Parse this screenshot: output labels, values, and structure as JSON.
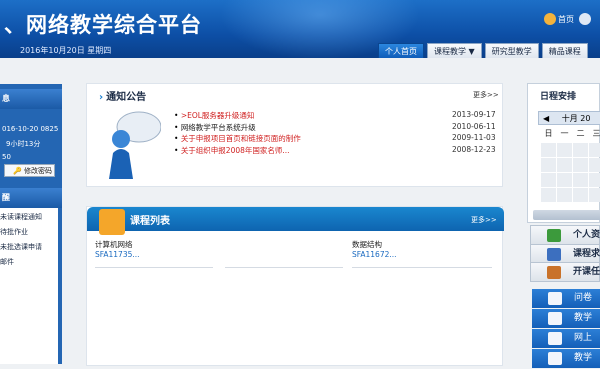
{
  "header": {
    "title": "、网络教学综合平台",
    "date": "2016年10月20日 星期四",
    "home_link": "首页",
    "nav_tabs": [
      "个人首页",
      "课程教学 ▼",
      "研究型教学",
      "精品课程"
    ]
  },
  "sidebar": {
    "head1": "息",
    "date_time": "016-10-20 0825",
    "duration": "9小时13分",
    "count": "50",
    "edit_password": "修改密码",
    "head2": "醒",
    "items": [
      "未读课程通知",
      "待批作业",
      "未批选课申请",
      "邮件"
    ]
  },
  "notice": {
    "title": "通知公告",
    "more": "更多>>",
    "items": [
      {
        "text": ">EOL服务器升级通知",
        "date": "2013-09-17",
        "color": "#d02020"
      },
      {
        "text": "网络教学平台系统升级",
        "date": "2010-06-11",
        "color": "#222222"
      },
      {
        "text": "关于申报项目首页和链接页面的制作",
        "date": "2009-11-03",
        "color": "#d02020"
      },
      {
        "text": "关于组织申报2008年国家名师...",
        "date": "2008-12-23",
        "color": "#d02020"
      }
    ]
  },
  "courses": {
    "title": "课程列表",
    "more": "更多>>",
    "items": [
      {
        "name": "计算机网络",
        "code": "SFA11735..."
      },
      {
        "name": "数据结构",
        "code": "SFA11672..."
      }
    ]
  },
  "calendar": {
    "title": "日程安排",
    "month": "十月 20",
    "weekdays": [
      "日",
      "一",
      "二",
      "三"
    ]
  },
  "right_links": [
    {
      "label": "个人资",
      "icon": "personal-icon",
      "color": "#3c9a3c"
    },
    {
      "label": "课程求",
      "icon": "course-request-icon",
      "color": "#3c6fbf"
    },
    {
      "label": "开课任",
      "icon": "task-icon",
      "color": "#c9722a"
    }
  ],
  "right_blue": [
    {
      "label": "问卷",
      "icon": "survey-icon"
    },
    {
      "label": "教学",
      "icon": "teaching-icon"
    },
    {
      "label": "网上",
      "icon": "mail-icon"
    },
    {
      "label": "教学",
      "icon": "chart-icon"
    }
  ]
}
